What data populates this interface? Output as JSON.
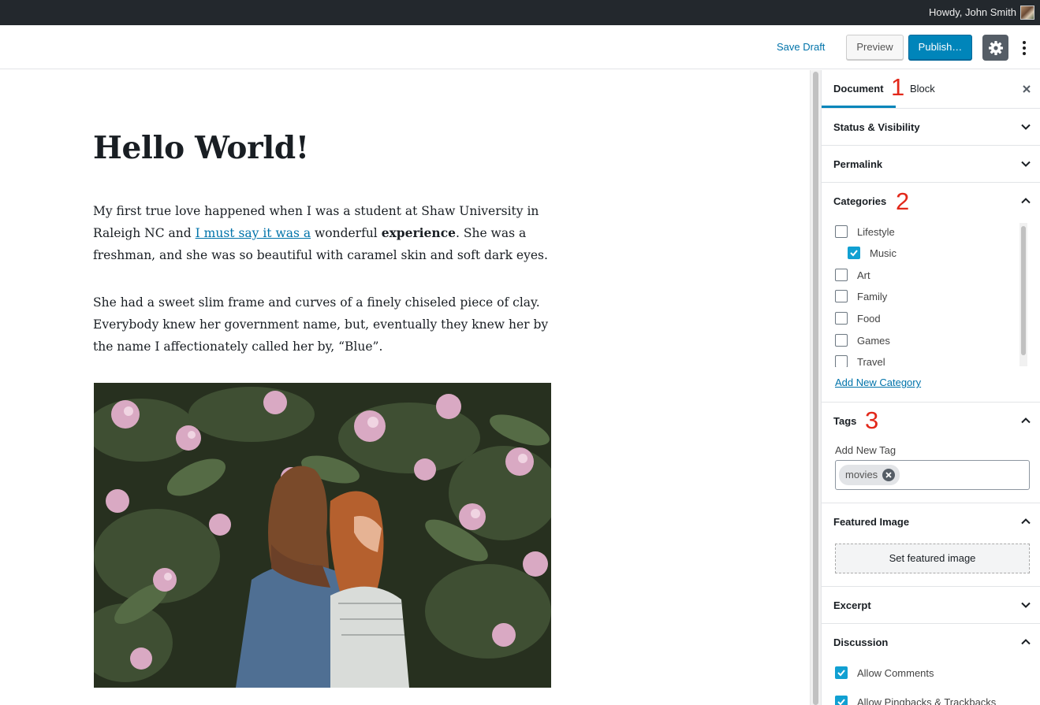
{
  "admin_bar": {
    "greeting": "Howdy, John Smith"
  },
  "toolbar": {
    "save_draft": "Save Draft",
    "preview": "Preview",
    "publish": "Publish…"
  },
  "post": {
    "title": "Hello World!",
    "p1_before_link": "My first true love happened when I was a student at Shaw University in Raleigh NC and ",
    "p1_link": "I must say it was a",
    "p1_middle": " wonderful ",
    "p1_bold": "experience",
    "p1_after": ". She was a freshman, and she was so beautiful with caramel skin and soft dark eyes.",
    "p2": "She had a sweet slim frame and curves of a finely chiseled piece of clay. Everybody knew her government name, but, eventually they knew her by the name I affectionately called her by, “Blue”."
  },
  "sidebar": {
    "tabs": [
      "Document",
      "Block"
    ],
    "annotations": [
      "1",
      "2",
      "3"
    ],
    "panels": {
      "status": "Status & Visibility",
      "permalink": "Permalink",
      "categories": "Categories",
      "tags": "Tags",
      "featured": "Featured Image",
      "excerpt": "Excerpt",
      "discussion": "Discussion"
    },
    "categories": [
      {
        "label": "Lifestyle",
        "checked": false
      },
      {
        "label": "Music",
        "checked": true
      },
      {
        "label": "Art",
        "checked": false
      },
      {
        "label": "Family",
        "checked": false
      },
      {
        "label": "Food",
        "checked": false
      },
      {
        "label": "Games",
        "checked": false
      },
      {
        "label": "Travel",
        "checked": false
      }
    ],
    "add_new_category": "Add New Category",
    "tags_field_label": "Add New Tag",
    "tags": [
      "movies"
    ],
    "set_featured_image": "Set featured image",
    "discussion_options": [
      {
        "label": "Allow Comments",
        "checked": true
      },
      {
        "label": "Allow Pingbacks & Trackbacks",
        "checked": true
      }
    ]
  },
  "colors": {
    "admin_bar": "#23282d",
    "publish": "#0085ba",
    "link": "#0073aa",
    "checkbox_checked": "#11a0d2",
    "annotation": "#e2281a"
  }
}
